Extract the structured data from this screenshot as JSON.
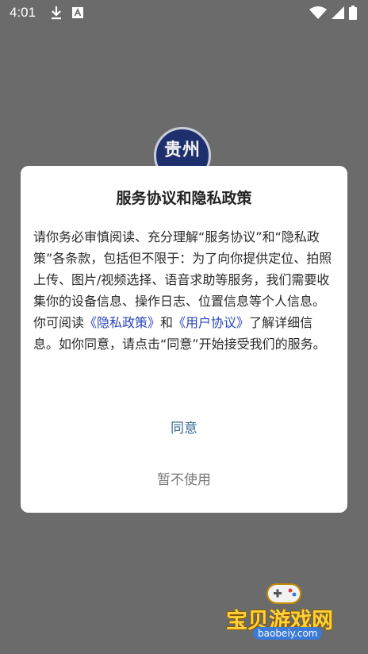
{
  "status_bar": {
    "time": "4:01"
  },
  "logo": {
    "text": "贵州"
  },
  "dialog": {
    "title": "服务协议和隐私政策",
    "body_part1": "请你务必审慎阅读、充分理解“服务协议”和“隐私政策”各条款，包括但不限于：为了向你提供定位、拍照上传、图片/视频选择、语音求助等服务，我们需要收集你的设备信息、操作日志、位置信息等个人信息。",
    "body_part2_prefix": "你可阅读",
    "privacy_link": "《隐私政策》",
    "and_text": "和",
    "user_link": "《用户协议》",
    "body_part2_suffix": "了解详细信息。如你同意，请点击“同意”开始接受我们的服务。",
    "agree_label": "同意",
    "decline_label": "暂不使用"
  },
  "watermark": {
    "title": "宝贝游戏网",
    "url": "baobeiy.com"
  }
}
